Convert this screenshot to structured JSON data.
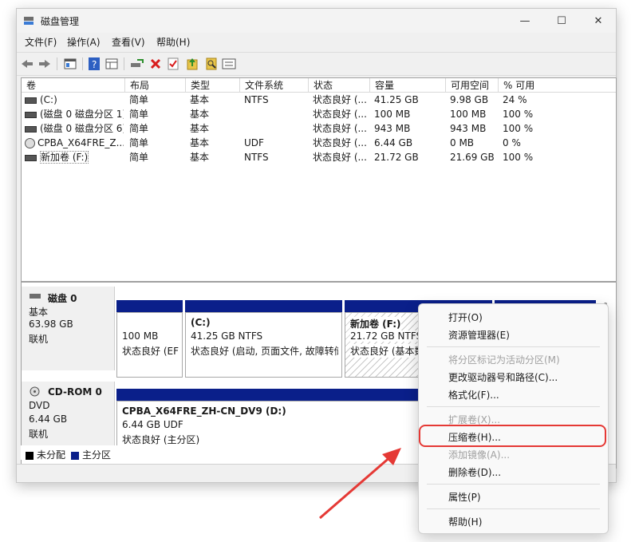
{
  "window": {
    "title": "磁盘管理",
    "minimize": "—",
    "maximize": "☐",
    "close": "✕"
  },
  "menu": [
    "文件(F)",
    "操作(A)",
    "查看(V)",
    "帮助(H)"
  ],
  "toolbar_icons": [
    "back-icon",
    "forward-icon",
    "properties-icon",
    "help-icon",
    "view-icon",
    "connect-icon",
    "delete-icon",
    "check-icon",
    "up-icon",
    "search-icon",
    "list-icon"
  ],
  "list": {
    "headers": [
      "卷",
      "布局",
      "类型",
      "文件系统",
      "状态",
      "容量",
      "可用空间",
      "% 可用"
    ],
    "rows": [
      {
        "vol": "(C:)",
        "layout": "简单",
        "type": "基本",
        "fs": "NTFS",
        "status": "状态良好 (...",
        "cap": "41.25 GB",
        "free": "9.98 GB",
        "pct": "24 %"
      },
      {
        "vol": "(磁盘 0 磁盘分区 1)",
        "layout": "简单",
        "type": "基本",
        "fs": "",
        "status": "状态良好 (...",
        "cap": "100 MB",
        "free": "100 MB",
        "pct": "100 %"
      },
      {
        "vol": "(磁盘 0 磁盘分区 6)",
        "layout": "简单",
        "type": "基本",
        "fs": "",
        "status": "状态良好 (...",
        "cap": "943 MB",
        "free": "943 MB",
        "pct": "100 %"
      },
      {
        "vol": "CPBA_X64FRE_Z...",
        "layout": "简单",
        "type": "基本",
        "fs": "UDF",
        "status": "状态良好 (...",
        "cap": "6.44 GB",
        "free": "0 MB",
        "pct": "0 %"
      },
      {
        "vol": "新加卷 (F:)",
        "layout": "简单",
        "type": "基本",
        "fs": "NTFS",
        "status": "状态良好 (...",
        "cap": "21.72 GB",
        "free": "21.69 GB",
        "pct": "100 %"
      }
    ]
  },
  "disk0": {
    "name": "磁盘 0",
    "type": "基本",
    "size": "63.98 GB",
    "state": "联机",
    "p1": {
      "size": "100 MB",
      "status": "状态良好 (EF"
    },
    "p2": {
      "name": "(C:)",
      "size": "41.25 GB NTFS",
      "status": "状态良好 (启动, 页面文件, 故障转储"
    },
    "p3": {
      "name": "新加卷  (F:)",
      "size": "21.72 GB NTFS",
      "status": "状态良好 (基本数"
    }
  },
  "cdrom0": {
    "name": "CD-ROM 0",
    "type": "DVD",
    "size": "6.44 GB",
    "state": "联机",
    "p1": {
      "name": "CPBA_X64FRE_ZH-CN_DV9  (D:)",
      "size": "6.44 GB UDF",
      "status": "状态良好 (主分区)"
    }
  },
  "legend": {
    "unalloc": "未分配",
    "primary": "主分区"
  },
  "colors": {
    "primary_bar": "#0a1f8a",
    "highlight": "#e53935",
    "arrow": "#e53935"
  },
  "context_menu": {
    "items": [
      {
        "label": "打开(O)",
        "disabled": false
      },
      {
        "label": "资源管理器(E)",
        "disabled": false
      },
      {
        "label": "将分区标记为活动分区(M)",
        "disabled": true
      },
      {
        "label": "更改驱动器号和路径(C)...",
        "disabled": false
      },
      {
        "label": "格式化(F)...",
        "disabled": false
      },
      {
        "label": "扩展卷(X)...",
        "disabled": true
      },
      {
        "label": "压缩卷(H)...",
        "disabled": false
      },
      {
        "label": "添加镜像(A)...",
        "disabled": true
      },
      {
        "label": "删除卷(D)...",
        "disabled": false
      },
      {
        "label": "属性(P)",
        "disabled": false
      },
      {
        "label": "帮助(H)",
        "disabled": false
      }
    ]
  }
}
